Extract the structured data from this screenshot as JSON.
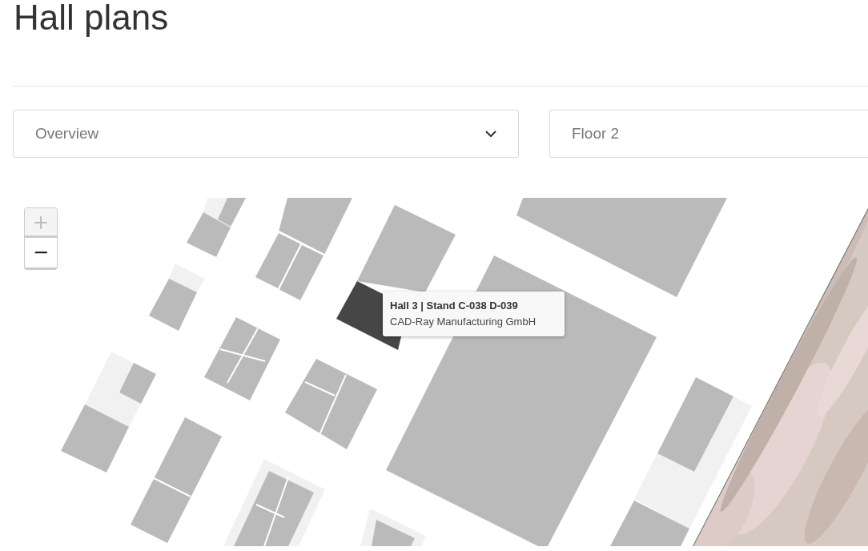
{
  "page_title": "Hall plans",
  "filters": [
    {
      "value": "Overview",
      "caret": true
    },
    {
      "value": "Floor 2",
      "caret": false
    }
  ],
  "map": {
    "zoom_controls": [
      {
        "label": "+",
        "disabled": true
      },
      {
        "label": "−",
        "disabled": false
      }
    ],
    "tooltip": {
      "title": "Hall 3 | Stand C-038 D-039",
      "subtitle": "CAD-Ray Manufacturing GmbH"
    }
  }
}
